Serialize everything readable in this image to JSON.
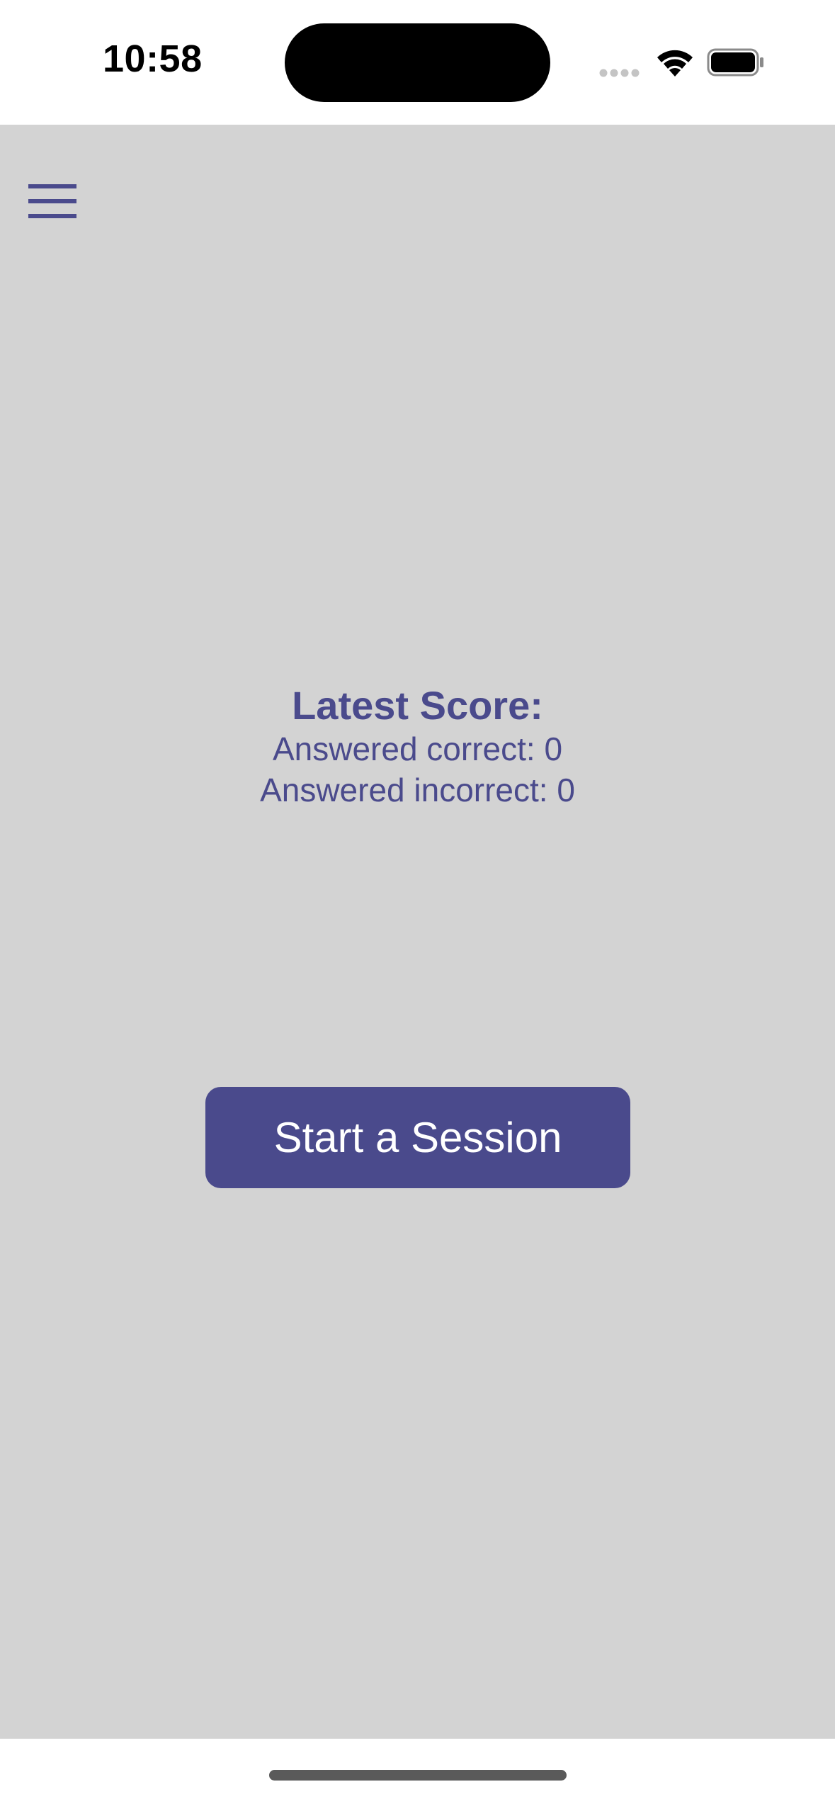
{
  "status_bar": {
    "time": "10:58"
  },
  "colors": {
    "accent": "#4a4a8c",
    "background": "#d3d3d3",
    "button_text": "#ffffff"
  },
  "header": {
    "menu_icon": "hamburger-menu-icon"
  },
  "score": {
    "title": "Latest Score:",
    "correct_text": "Answered correct: 0",
    "incorrect_text": "Answered incorrect: 0"
  },
  "actions": {
    "start_label": "Start a Session"
  }
}
